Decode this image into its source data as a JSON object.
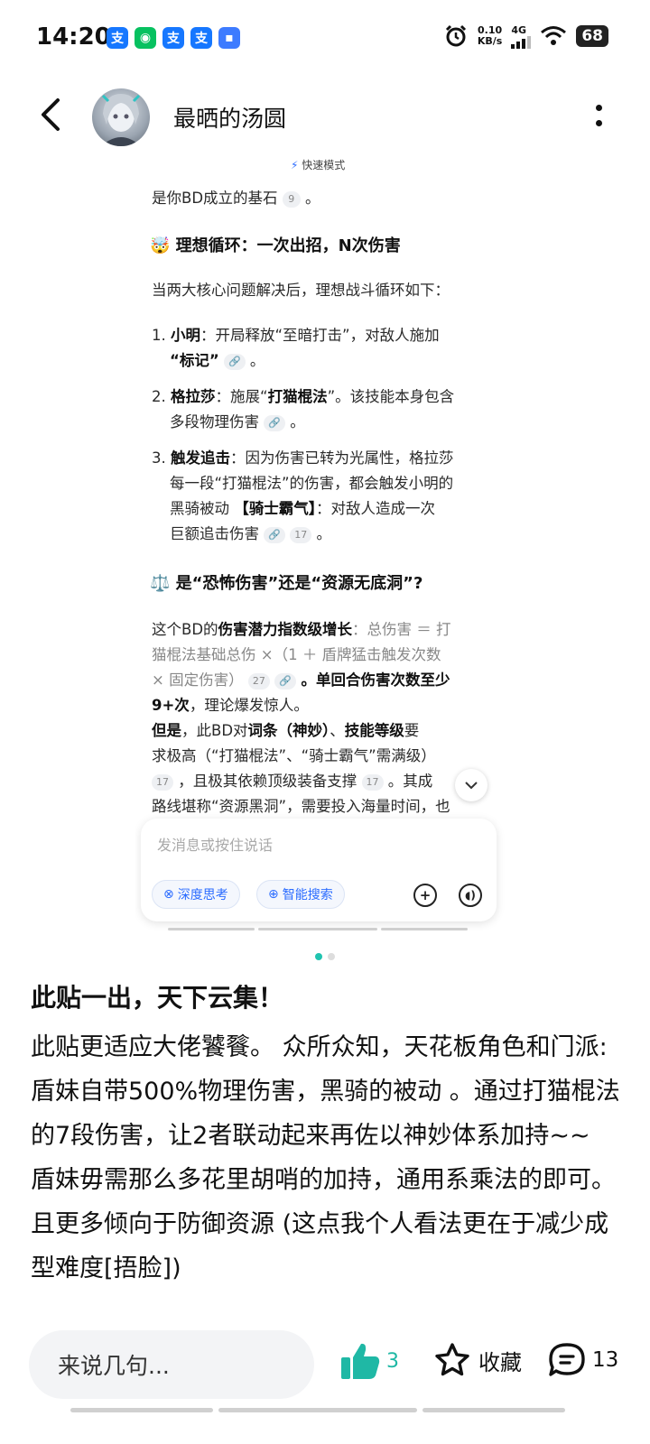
{
  "status_bar": {
    "time": "14:20",
    "apps": [
      {
        "icon": "alipay-icon",
        "glyph": "支",
        "color": "#1677ff"
      },
      {
        "icon": "wechat-icon",
        "glyph": "◉",
        "color": "#07c160"
      },
      {
        "icon": "alipay-icon",
        "glyph": "支",
        "color": "#1677ff"
      },
      {
        "icon": "alipay-icon",
        "glyph": "支",
        "color": "#1677ff"
      },
      {
        "icon": "message-icon",
        "glyph": "▪",
        "color": "#3d7bff"
      }
    ],
    "net_speed_value": "0.10",
    "net_speed_unit": "KB/s",
    "signal_label": "4G",
    "battery": "68"
  },
  "header": {
    "author_name": "最晒的汤圆"
  },
  "embedded_image": {
    "mode_label": "快速模式",
    "line_1": "是你BD成立的基石",
    "line_1_cite": "9",
    "heading_1": "🤯 理想循环：一次出招，N次伤害",
    "intro": "当两大核心问题解决后，理想战斗循环如下：",
    "items": [
      {
        "num": "1.",
        "lead": "小明",
        "text_a": "：开局释放“至暗打击”，对敌人施加",
        "text_b_bold": "“标记”",
        "text_c": " 。"
      },
      {
        "num": "2.",
        "lead": "格拉莎",
        "text_a": "：施展“",
        "text_b_bold": "打猫棍法",
        "text_c": "”。该技能本身包含",
        "line2": "多段物理伤害"
      },
      {
        "num": "3.",
        "lead": "触发追击",
        "text_a": "：因为伤害已转为光属性，格拉莎",
        "line2": "每一段“打猫棍法”的伤害，都会触发小明的",
        "line3a": "黑骑被动 ",
        "line3b_bold": "【骑士霸气】",
        "line3c": "：对敌人造成一次",
        "line4": "巨额追击伤害",
        "cite": "17"
      }
    ],
    "heading_2": "⚖️ 是“恐怖伤害”还是“资源无底洞”?",
    "para_1_a": "这个BD的",
    "para_1_bold": "伤害潜力指数级增长",
    "para_1_b": "：总伤害 ＝ 打",
    "para_1_l2": "猫棍法基础总伤 ×（1 ＋ 盾牌猛击触发次数",
    "para_1_l3": "× 固定伤害）",
    "para_1_cite": "27",
    "para_1_c": " 。单回合伤害次数",
    "para_1_c_bold": "至少",
    "para_1_l4_bold": "9+次",
    "para_1_l4": "，理论爆发惊人。",
    "para_2_bold_a": "但是",
    "para_2_a": "，此BD对",
    "para_2_bold_b": "词条（神妙）",
    "para_2_b": "、",
    "para_2_bold_c": "技能等级",
    "para_2_c": "要",
    "para_2_l2": "求极高（“打猫棍法”、“骑士霸气”需满级）",
    "para_2_cite_1": "17",
    "para_2_l3": " ，且极其依赖顶级装备支撑",
    "para_2_cite_2": "17",
    "para_2_l3_end": " 。其成",
    "para_2_l4": "路线堪称“资源黑洞”，需要投入海量时间，也",
    "chat_placeholder": "发消息或按住说话",
    "chip_1": "深度思考",
    "chip_2": "智能搜索"
  },
  "post": {
    "title": "此贴一出，天下云集！",
    "body": "此贴更适应大佬饕餮。 众所众知，天花板角色和门派:盾妹自带500%物理伤害，黑骑的被动 。通过打猫棍法的7段伤害，让2者联动起来再佐以神妙体系加持~~\n盾妹毋需那么多花里胡哨的加持，通用系乘法的即可。且更多倾向于防御资源 (这点我个人看法更在于减少成型难度[捂脸])"
  },
  "bottom_bar": {
    "comment_placeholder": "来说几句...",
    "like_count": "3",
    "fav_label": "收藏",
    "comment_count": "13",
    "accent_color": "#1fb8a5"
  }
}
